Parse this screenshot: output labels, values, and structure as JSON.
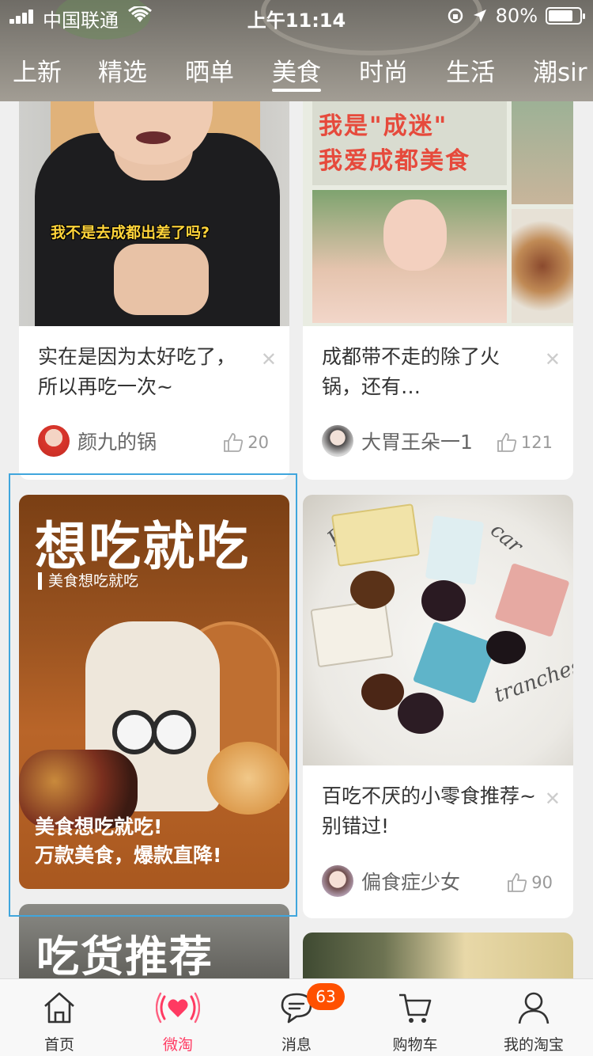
{
  "status_bar": {
    "carrier": "中国联通",
    "time": "上午11:14",
    "battery": "80%",
    "battery_level": 0.8
  },
  "tabs": [
    {
      "label": "上新"
    },
    {
      "label": "精选"
    },
    {
      "label": "晒单"
    },
    {
      "label": "美食",
      "active": true
    },
    {
      "label": "时尚"
    },
    {
      "label": "生活"
    },
    {
      "label": "潮sir"
    }
  ],
  "feed": {
    "card1": {
      "image_caption": "我不是去成都出差了吗?",
      "title": "实在是因为太好吃了，所以再吃一次~",
      "author": "颜九的锅",
      "likes": "20"
    },
    "card2": {
      "image_line1": "我是\"成迷\"",
      "image_line2": "我爱成都美食",
      "title": "成都带不走的除了火锅，还有…",
      "author": "大胃王朵一1",
      "likes": "121"
    },
    "ad_card": {
      "headline": "想吃就吃",
      "tag": "美食想吃就吃",
      "line1": "美食想吃就吃!",
      "line2": "万款美食，爆款直降!"
    },
    "card3": {
      "title": "百吃不厌的小零食推荐~别错过!",
      "author": "偏食症少女",
      "likes": "90"
    },
    "card4": {
      "image_text": "吃货推荐"
    }
  },
  "bottom_nav": [
    {
      "label": "首页",
      "icon": "home-icon"
    },
    {
      "label": "微淘",
      "icon": "weitao-heart-icon",
      "active": true
    },
    {
      "label": "消息",
      "icon": "message-icon",
      "badge": "63"
    },
    {
      "label": "购物车",
      "icon": "cart-icon"
    },
    {
      "label": "我的淘宝",
      "icon": "profile-icon"
    }
  ],
  "colors": {
    "accent": "#ff3a62",
    "badge": "#ff5000",
    "selection": "#40a6dd"
  }
}
